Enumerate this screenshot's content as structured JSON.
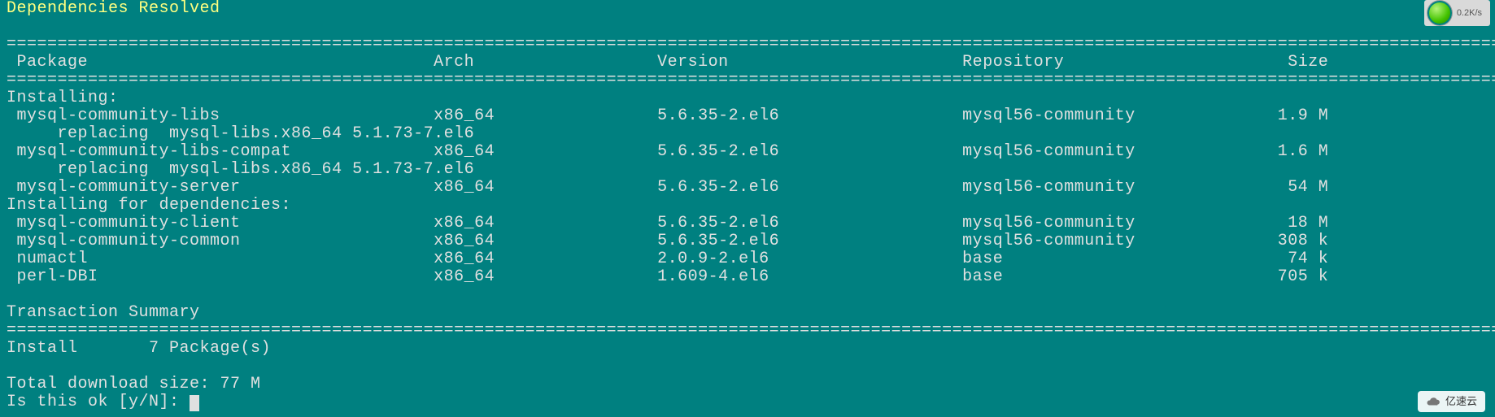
{
  "title_line": "Dependencies Resolved",
  "rule": "========================================================================================================================================================================",
  "header": {
    "package": "Package",
    "arch": "Arch",
    "version": "Version",
    "repository": "Repository",
    "size": "Size"
  },
  "section_installing": "Installing:",
  "rows_installing": [
    {
      "package": "mysql-community-libs",
      "arch": "x86_64",
      "version": "5.6.35-2.el6",
      "repository": "mysql56-community",
      "size": "1.9 M",
      "replacing": "replacing  mysql-libs.x86_64 5.1.73-7.el6"
    },
    {
      "package": "mysql-community-libs-compat",
      "arch": "x86_64",
      "version": "5.6.35-2.el6",
      "repository": "mysql56-community",
      "size": "1.6 M",
      "replacing": "replacing  mysql-libs.x86_64 5.1.73-7.el6"
    },
    {
      "package": "mysql-community-server",
      "arch": "x86_64",
      "version": "5.6.35-2.el6",
      "repository": "mysql56-community",
      "size": "54 M",
      "replacing": ""
    }
  ],
  "section_deps": "Installing for dependencies:",
  "rows_deps": [
    {
      "package": "mysql-community-client",
      "arch": "x86_64",
      "version": "5.6.35-2.el6",
      "repository": "mysql56-community",
      "size": "18 M"
    },
    {
      "package": "mysql-community-common",
      "arch": "x86_64",
      "version": "5.6.35-2.el6",
      "repository": "mysql56-community",
      "size": "308 k"
    },
    {
      "package": "numactl",
      "arch": "x86_64",
      "version": "2.0.9-2.el6",
      "repository": "base",
      "size": "74 k"
    },
    {
      "package": "perl-DBI",
      "arch": "x86_64",
      "version": "1.609-4.el6",
      "repository": "base",
      "size": "705 k"
    }
  ],
  "summary_heading": "Transaction Summary",
  "summary_line": "Install       7 Package(s)",
  "total_line": "Total download size: 77 M",
  "prompt": "Is this ok [y/N]: ",
  "watermark": "亿速云",
  "badge": "0.2K/s",
  "cols": {
    "package": 1,
    "arch": 42,
    "version": 64,
    "repository": 94,
    "size_end": 130
  }
}
